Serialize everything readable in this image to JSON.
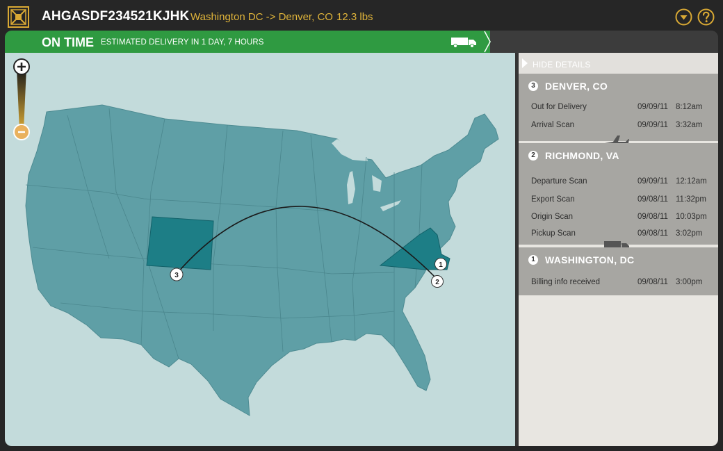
{
  "header": {
    "tracking_number": "AHGASDF234521KJHK",
    "route": "Washington DC -> Denver, CO",
    "weight": "12.3 lbs"
  },
  "status": {
    "title": "ON TIME",
    "estimate": "ESTIMATED DELIVERY IN 1 DAY, 7 HOURS"
  },
  "map": {
    "markers": [
      "3",
      "1",
      "2"
    ]
  },
  "details": {
    "hide_label": "HIDE DETAILS",
    "stops": [
      {
        "num": "3",
        "name": "DENVER, CO",
        "events": [
          {
            "event": "Out for Delivery",
            "date": "09/09/11",
            "time": "8:12am"
          },
          {
            "event": "Arrival Scan",
            "date": "09/09/11",
            "time": "3:32am"
          }
        ]
      },
      {
        "num": "2",
        "name": "RICHMOND, VA",
        "events": [
          {
            "event": "Departure Scan",
            "date": "09/09/11",
            "time": "12:12am"
          },
          {
            "event": "Export Scan",
            "date": "09/08/11",
            "time": "11:32pm"
          },
          {
            "event": "Origin Scan",
            "date": "09/08/11",
            "time": "10:03pm"
          },
          {
            "event": "Pickup Scan",
            "date": "09/08/11",
            "time": "3:02pm"
          }
        ]
      },
      {
        "num": "1",
        "name": "WASHINGTON, DC",
        "events": [
          {
            "event": "Billing info received",
            "date": "09/08/11",
            "time": "3:00pm"
          }
        ]
      }
    ]
  },
  "colors": {
    "accent": "#e0b43a",
    "status_green": "#2f9a41",
    "map_land": "#5f9fa6",
    "map_highlight": "#1d7e86",
    "map_water": "#c3dbdb"
  },
  "icons": {
    "logo": "package-logo-icon",
    "dropdown": "dropdown-circle-icon",
    "help": "help-circle-icon",
    "truck": "truck-icon",
    "plane": "airplane-icon",
    "zoom_in": "zoom-in-icon",
    "zoom_out": "zoom-out-icon"
  }
}
